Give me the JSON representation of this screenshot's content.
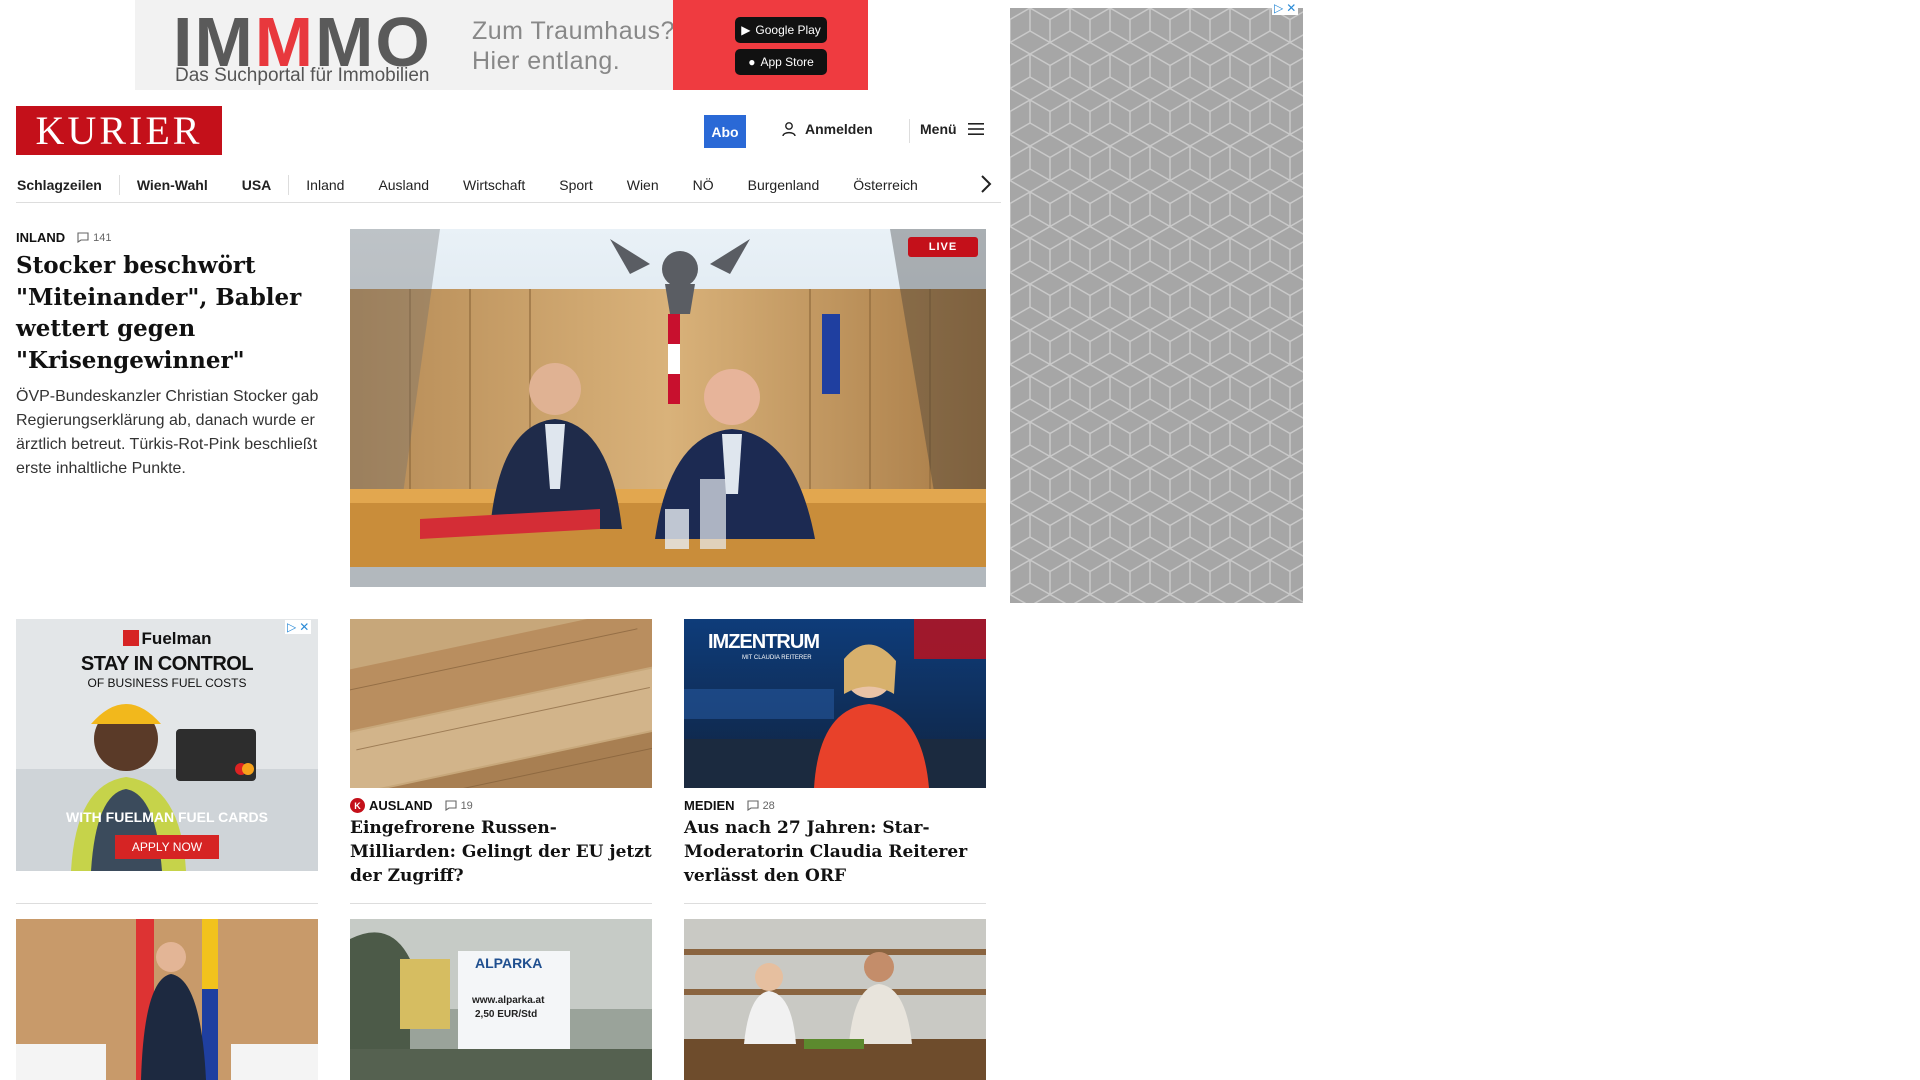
{
  "top_ad": {
    "brand_part1": "IM",
    "brand_part2": "M",
    "brand_part3": "MO",
    "subline": "Das Suchportal für Immobilien",
    "slogan_line1": "Zum Traumhaus?",
    "slogan_line2": "Hier entlang.",
    "google_play": "Google Play",
    "app_store": "App Store"
  },
  "header": {
    "logo": "KURIER",
    "abo": "Abo",
    "login": "Anmelden",
    "menu": "Menü"
  },
  "nav": {
    "items": [
      "Schlagzeilen",
      "Wien-Wahl",
      "USA",
      "Inland",
      "Ausland",
      "Wirtschaft",
      "Sport",
      "Wien",
      "NÖ",
      "Burgenland",
      "Österreich"
    ]
  },
  "lead": {
    "category": "INLAND",
    "comments": "141",
    "title": "Stocker beschwört \"Miteinander\", Babler wettert gegen \"Krisengewinner\"",
    "description": "ÖVP-Bundeskanzler Christian Stocker gab Regierungserklärung ab, danach wurde er ärztlich betreut. Türkis-Rot-Pink beschließt erste inhaltliche Punkte.",
    "live": "LIVE"
  },
  "fuel_ad": {
    "brand": "Fuelman",
    "headline": "STAY IN CONTROL",
    "subhead": "OF BUSINESS FUEL COSTS",
    "tagline": "WITH FUELMAN FUEL CARDS",
    "cta": "APPLY NOW"
  },
  "cards": [
    {
      "category": "AUSLAND",
      "comments": "19",
      "title": "Eingefrorene Russen-Milliarden: Gelingt der EU jetzt der Zugriff?"
    },
    {
      "category": "MEDIEN",
      "comments": "28",
      "title": "Aus nach 27 Jahren: Star-Moderatorin Claudia Reiterer verlässt den ORF"
    }
  ],
  "card_imagery": {
    "imzentrum": "IMZENTRUM",
    "imzentrum_sub": "MIT CLAUDIA REITERER",
    "alparka": "ALPARKA",
    "alparka_url": "www.alparka.at",
    "alparka_price": "2,50 EUR/Std"
  },
  "colors": {
    "brand_red": "#c4101a",
    "abo_blue": "#2a69d6",
    "ad_red": "#ef3b40"
  }
}
